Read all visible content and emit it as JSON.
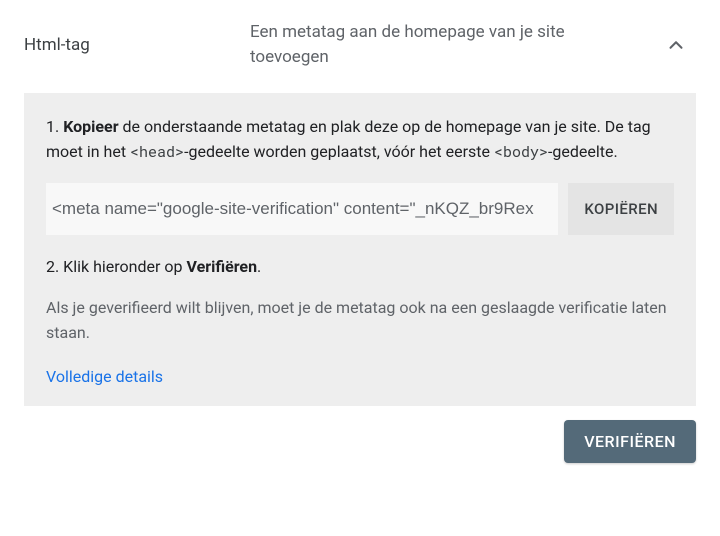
{
  "header": {
    "title": "Html-tag",
    "subtitle": "Een metatag aan de homepage van je site toevoegen"
  },
  "step1": {
    "prefix": "1. ",
    "bold": "Kopieer",
    "text_after_bold": " de onderstaande metatag en plak deze op de homepage van je site. De tag moet in het ",
    "code1": "<head>",
    "text_mid": "-gedeelte worden geplaatst, vóór het eerste ",
    "code2": "<body>",
    "text_end": "-gedeelte."
  },
  "meta_tag": "<meta name=\"google-site-verification\" content=\"_nKQZ_br9Rex",
  "copy_label": "KOPIËREN",
  "step2": {
    "prefix": "2. Klik hieronder op ",
    "bold": "Verifiëren",
    "suffix": "."
  },
  "note": "Als je geverifieerd wilt blijven, moet je de metatag ook na een geslaagde verificatie laten staan.",
  "details_link": "Volledige details",
  "verify_label": "VERIFIËREN"
}
